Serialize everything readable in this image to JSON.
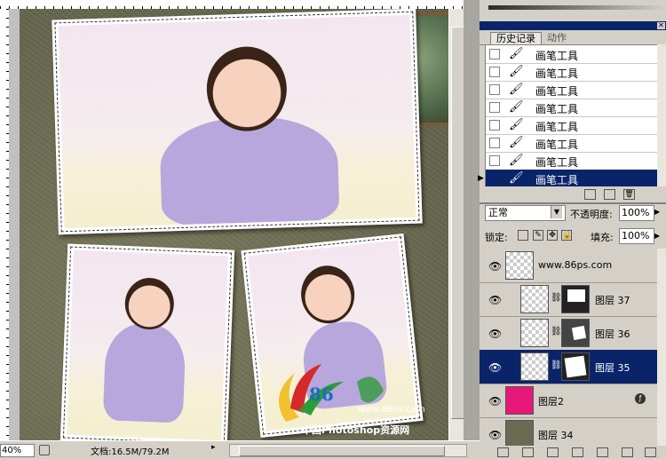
{
  "status": {
    "zoom": "40%",
    "doc_info": "文档:16.5M/79.2M",
    "arrow": "▸"
  },
  "watermark": {
    "number": "86",
    "url": "www.86ps.com",
    "site_name": "中国Photoshop资源网"
  },
  "history": {
    "tabs": [
      {
        "label": "历史记录",
        "active": true
      },
      {
        "label": "动作",
        "active": false
      }
    ],
    "items": [
      {
        "label": "画笔工具",
        "selected": false
      },
      {
        "label": "画笔工具",
        "selected": false
      },
      {
        "label": "画笔工具",
        "selected": false
      },
      {
        "label": "画笔工具",
        "selected": false
      },
      {
        "label": "画笔工具",
        "selected": false
      },
      {
        "label": "画笔工具",
        "selected": false
      },
      {
        "label": "画笔工具",
        "selected": false
      },
      {
        "label": "画笔工具",
        "selected": true
      }
    ]
  },
  "layers": {
    "blend_mode": "正常",
    "opacity_label": "不透明度:",
    "opacity": "100%",
    "lock_label": "锁定:",
    "fill_label": "填充:",
    "fill": "100%",
    "items": [
      {
        "name": "www.86ps.com",
        "selected": false
      },
      {
        "name": "图层 37",
        "selected": false
      },
      {
        "name": "图层 36",
        "selected": false
      },
      {
        "name": "图层 35",
        "selected": true
      },
      {
        "name": "图层2",
        "selected": false
      },
      {
        "name": "图层 34",
        "selected": false
      }
    ]
  },
  "colors": {
    "selection": "#0a246a",
    "panel": "#d4d0c8",
    "canvas_bg": "#6b6a52",
    "layer2_thumb": "#e8177a"
  },
  "icons": {
    "eye": "eye-icon",
    "brush": "brush-icon",
    "chain": "chain-link-icon",
    "fx": "layer-style-icon"
  }
}
